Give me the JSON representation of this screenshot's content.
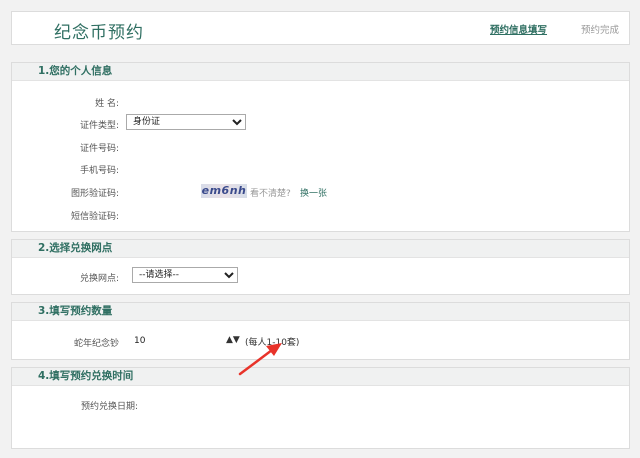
{
  "header": {
    "title": "纪念币预约",
    "step_current": "预约信息填写",
    "step_next": "预约完成"
  },
  "section1": {
    "title": "1.您的个人信息",
    "name_label": "姓 名:",
    "id_type_label": "证件类型:",
    "id_type_value": "身份证",
    "id_number_label": "证件号码:",
    "phone_label": "手机号码:",
    "captcha_label": "图形验证码:",
    "captcha_text": "em6nh",
    "captcha_hint": "看不清楚?",
    "captcha_refresh": "换一张",
    "sms_label": "短信验证码:"
  },
  "section2": {
    "title": "2.选择兑换网点",
    "outlet_label": "兑换网点:",
    "outlet_value": "--请选择--"
  },
  "section3": {
    "title": "3.填写预约数量",
    "coin_label": "蛇年纪念钞",
    "quantity": "10",
    "stepper": "▲▼",
    "limit": "(每人1-10套)"
  },
  "section4": {
    "title": "4.填写预约兑换时间",
    "date_label": "预约兑换日期:"
  },
  "colors": {
    "accent": "#2f6f62",
    "arrow": "#e8332a"
  }
}
